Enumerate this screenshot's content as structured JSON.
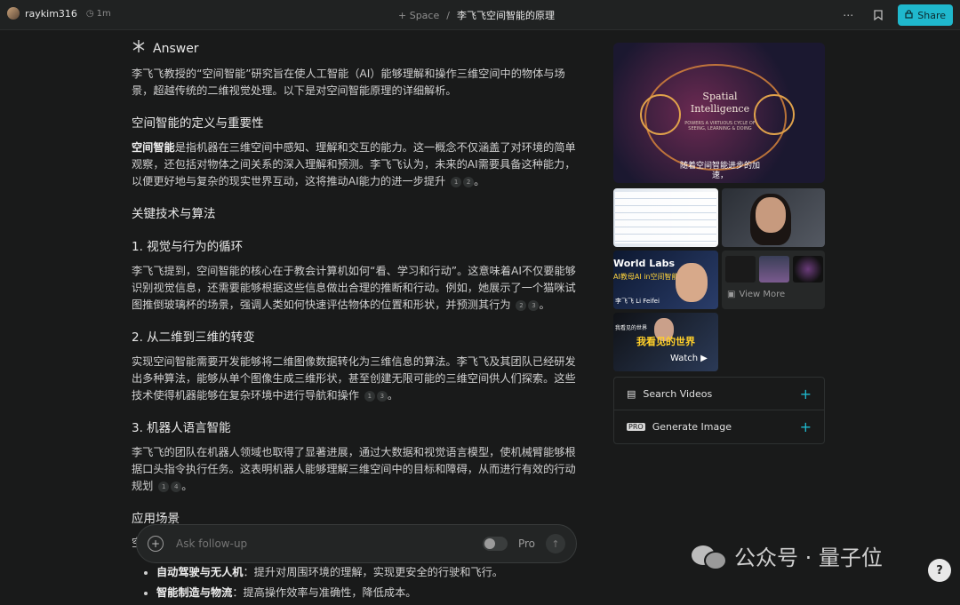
{
  "topbar": {
    "username": "raykim316",
    "time": "1m",
    "space_label": "+ Space",
    "separator": "/",
    "thread_title": "李飞飞空间智能的原理",
    "share_label": "Share"
  },
  "answer": {
    "heading": "Answer",
    "intro": "李飞飞教授的“空间智能”研究旨在使人工智能（AI）能够理解和操作三维空间中的物体与场景，超越传统的二维视觉处理。以下是对空间智能原理的详细解析。",
    "sec1_title": "空间智能的定义与重要性",
    "sec1_bold": "空间智能",
    "sec1_text": "是指机器在三维空间中感知、理解和交互的能力。这一概念不仅涵盖了对环境的简单观察，还包括对物体之间关系的深入理解和预测。李飞飞认为，未来的AI需要具备这种能力，以便更好地与复杂的现实世界互动，这将推动AI能力的进一步提升",
    "sec1_c1": "1",
    "sec1_c2": "2",
    "sec2_title": "关键技术与算法",
    "h31": "1. 视觉与行为的循环",
    "p31": "李飞飞提到，空间智能的核心在于教会计算机如何“看、学习和行动”。这意味着AI不仅要能够识别视觉信息，还需要能够根据这些信息做出合理的推断和行动。例如，她展示了一个猫咪试图推倒玻璃杯的场景，强调人类如何快速评估物体的位置和形状，并预测其行为",
    "p31_c1": "2",
    "p31_c2": "3",
    "h32": "2. 从二维到三维的转变",
    "p32": "实现空间智能需要开发能够将二维图像数据转化为三维信息的算法。李飞飞及其团队已经研发出多种算法，能够从单个图像生成三维形状，甚至创建无限可能的三维空间供人们探索。这些技术使得机器能够在复杂环境中进行导航和操作",
    "p32_c1": "1",
    "p32_c2": "3",
    "h33": "3. 机器人语言智能",
    "p33": "李飞飞的团队在机器人领域也取得了显著进展，通过大数据和视觉语言模型，使机械臂能够根据口头指令执行任务。这表明机器人能够理解三维空间中的目标和障碍，从而进行有效的行动规划",
    "p33_c1": "1",
    "p33_c2": "4",
    "sec3_title": "应用场景",
    "sec3_partial": "空",
    "bullet1_bold": "自动驾驶与无人机",
    "bullet1_text": "：提升对周围环境的理解，实现更安全的行驶和飞行。",
    "bullet2_bold": "智能制造与物流",
    "bullet2_text": "：提高操作效率与准确性，降低成本。"
  },
  "composer": {
    "placeholder": "Ask follow-up",
    "pro_label": "Pro"
  },
  "media": {
    "hero_title": "Spatial Intelligence",
    "hero_sub": "POWERS A VIRTUOUS CYCLE OF SEEING, LEARNING & DOING",
    "hero_caption": "随着空间智能进步的加速，",
    "t3_title": "World Labs",
    "t3_sub": "AI教母AI in空间智能",
    "t3_name": "李飞飞 Li Feifei",
    "view_more": "View More",
    "t5_title": "我看见的世界",
    "t5_small": "我看见的世界",
    "watch": "Watch"
  },
  "actions": {
    "search_videos": "Search Videos",
    "generate_image": "Generate Image"
  },
  "watermark": {
    "text": "公众号 · 量子位"
  },
  "help": {
    "label": "?"
  }
}
